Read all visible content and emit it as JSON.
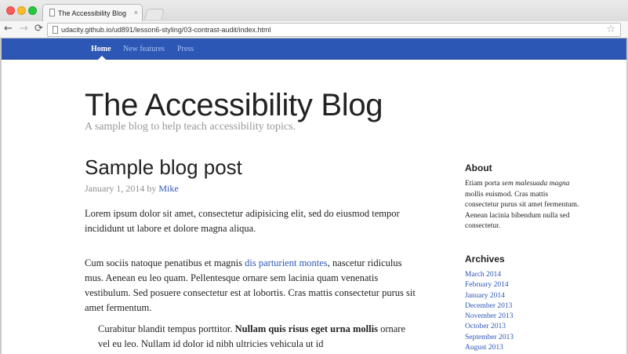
{
  "browser": {
    "tab_title": "The Accessibility Blog",
    "tab_close": "×",
    "url": "udacity.github.io/ud891/lesson6-styling/03-contrast-audit/index.html",
    "back_glyph": "←",
    "forward_glyph": "→",
    "reload_glyph": "⟳",
    "star_glyph": "☆"
  },
  "nav": {
    "items": [
      {
        "label": "Home",
        "active": true
      },
      {
        "label": "New features",
        "active": false
      },
      {
        "label": "Press",
        "active": false
      }
    ]
  },
  "header": {
    "title": "The Accessibility Blog",
    "tagline": "A sample blog to help teach accessibility topics."
  },
  "post": {
    "title": "Sample blog post",
    "date": "January 1, 2014",
    "by": "by",
    "author": "Mike",
    "p1": "Lorem ipsum dolor sit amet, consectetur adipisicing elit, sed do eiusmod tempor incididunt ut labore et dolore magna aliqua.",
    "p2_before": "Cum sociis natoque penatibus et magnis ",
    "p2_link": "dis parturient montes",
    "p2_after": ", nascetur ridiculus mus. Aenean eu leo quam. Pellentesque ornare sem lacinia quam venenatis vestibulum. Sed posuere consectetur est at lobortis. Cras mattis consectetur purus sit amet fermentum.",
    "quote_before": "Curabitur blandit tempus porttitor. ",
    "quote_bold": "Nullam quis risus eget urna mollis",
    "quote_after": " ornare vel eu leo. Nullam id dolor id nibh ultricies vehicula ut id"
  },
  "sidebar": {
    "about_heading": "About",
    "about_before": "Etiam porta ",
    "about_em": "sem malesuada magna",
    "about_after": " mollis euismod. Cras mattis consectetur purus sit amet fermentum. Aenean lacinia bibendum nulla sed consectetur.",
    "archives_heading": "Archives",
    "archives": [
      "March 2014",
      "February 2014",
      "January 2014",
      "December 2013",
      "November 2013",
      "October 2013",
      "September 2013",
      "August 2013"
    ]
  },
  "colors": {
    "nav_bg": "#2d57b5",
    "link": "#2d57b5",
    "nav_inactive": "#a7c2f1",
    "muted_text": "#979797"
  }
}
